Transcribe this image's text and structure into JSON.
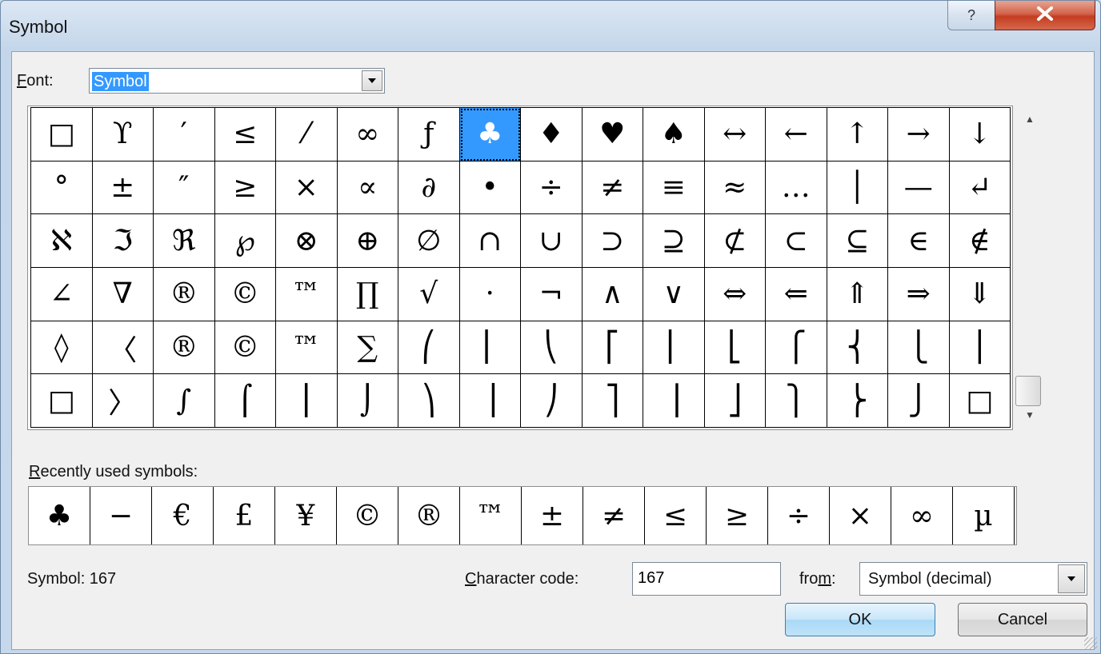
{
  "window": {
    "title": "Symbol",
    "help_icon": "?",
    "close_icon": "X"
  },
  "font": {
    "label_accel": "F",
    "label_rest": "ont:",
    "value": "Symbol",
    "dropdown_icon": "chevron-down-icon"
  },
  "symbol_grid": {
    "selected_index": 7,
    "rows": [
      [
        "□",
        "ϒ",
        "′",
        "≤",
        "⁄",
        "∞",
        "ƒ",
        "♣",
        "♦",
        "♥",
        "♠",
        "↔",
        "←",
        "↑",
        "→",
        "↓"
      ],
      [
        "°",
        "±",
        "″",
        "≥",
        "×",
        "∝",
        "∂",
        "•",
        "÷",
        "≠",
        "≡",
        "≈",
        "…",
        "│",
        "—",
        "↵"
      ],
      [
        "ℵ",
        "ℑ",
        "ℜ",
        "℘",
        "⊗",
        "⊕",
        "∅",
        "∩",
        "∪",
        "⊃",
        "⊇",
        "⊄",
        "⊂",
        "⊆",
        "∈",
        "∉"
      ],
      [
        "∠",
        "∇",
        "®",
        "©",
        "™",
        "∏",
        "√",
        "·",
        "¬",
        "∧",
        "∨",
        "⇔",
        "⇐",
        "⇑",
        "⇒",
        "⇓"
      ],
      [
        "◊",
        "〈",
        "®",
        "©",
        "™",
        "∑",
        "⎛",
        "⎜",
        "⎝",
        "⎡",
        "⎢",
        "⎣",
        "⎧",
        "⎨",
        "⎩",
        "⎪"
      ],
      [
        "□",
        "〉",
        "∫",
        "⌠",
        "⎮",
        "⌡",
        "⎞",
        "⎟",
        "⎠",
        "⎤",
        "⎥",
        "⎦",
        "⎫",
        "⎬",
        "⎭",
        "□"
      ]
    ]
  },
  "recent": {
    "label_accel": "R",
    "label_rest": "ecently used symbols:",
    "symbols": [
      "♣",
      "−",
      "€",
      "£",
      "¥",
      "©",
      "®",
      "™",
      "±",
      "≠",
      "≤",
      "≥",
      "÷",
      "×",
      "∞",
      "µ"
    ]
  },
  "status": {
    "symbol_readout": "Symbol: 167"
  },
  "char_code": {
    "label_accel": "C",
    "label_rest": "haracter code:",
    "value": "167"
  },
  "from": {
    "label_pre": "fro",
    "label_accel": "m",
    "label_post": ":",
    "value": "Symbol (decimal)"
  },
  "buttons": {
    "ok": "OK",
    "cancel": "Cancel"
  }
}
